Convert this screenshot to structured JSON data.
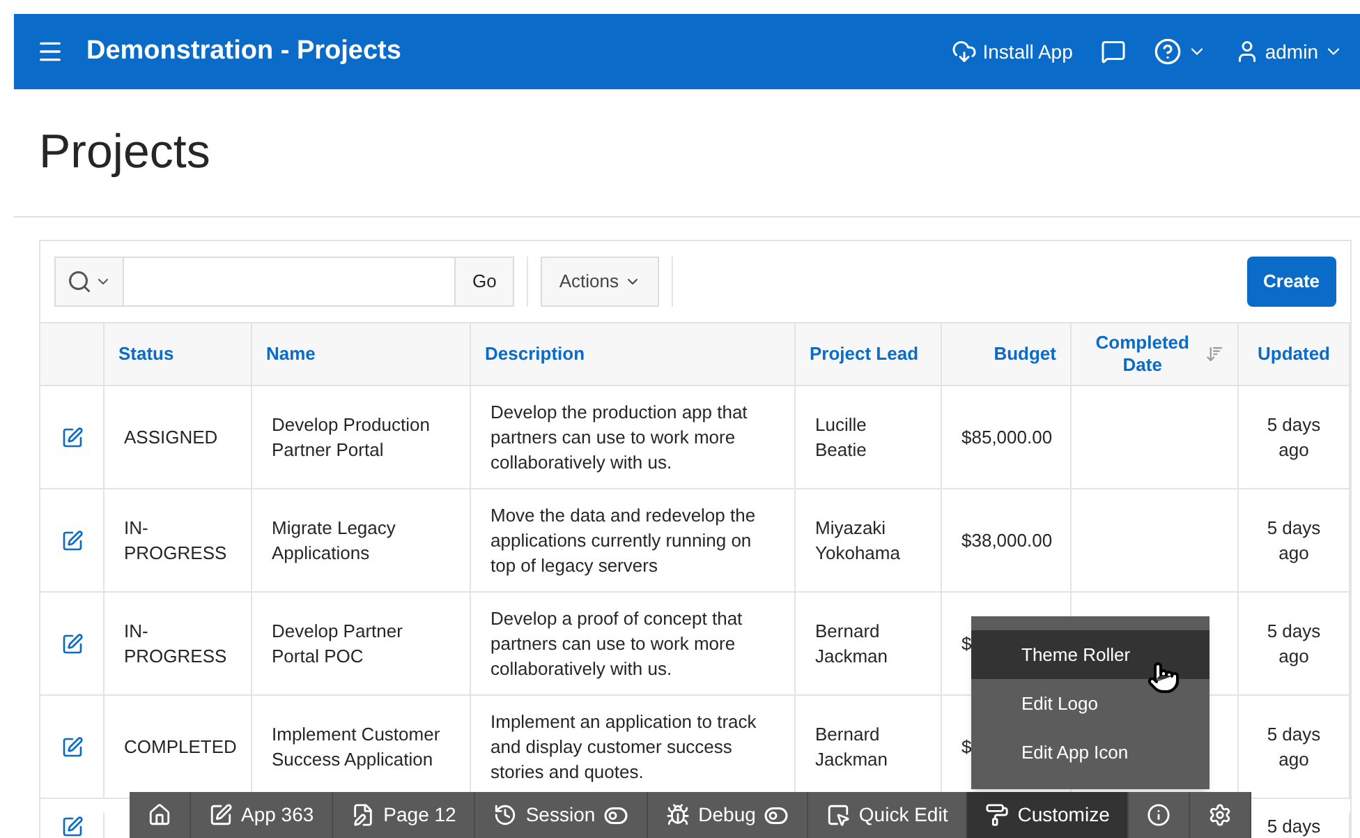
{
  "header": {
    "title": "Demonstration - Projects",
    "install": "Install App",
    "user": "admin"
  },
  "page": {
    "title": "Projects"
  },
  "toolbar": {
    "go": "Go",
    "actions": "Actions",
    "create": "Create"
  },
  "table": {
    "columns": [
      {
        "label": "Status",
        "sorted": false
      },
      {
        "label": "Name",
        "sorted": false
      },
      {
        "label": "Description",
        "sorted": false
      },
      {
        "label": "Project Lead",
        "sorted": false
      },
      {
        "label": "Budget",
        "sorted": false
      },
      {
        "label": "Completed Date",
        "sorted": true
      },
      {
        "label": "Updated",
        "sorted": false
      }
    ],
    "rows": [
      {
        "cells": [
          "ASSIGNED",
          "Develop Production Partner Portal",
          "Develop the production app that partners can use to work more collaboratively with us.",
          "Lucille Beatie",
          "$85,000.00",
          "",
          "5 days ago"
        ]
      },
      {
        "cells": [
          "IN-PROGRESS",
          "Migrate Legacy Applications",
          "Move the data and redevelop the applications currently running on top of legacy servers",
          "Miyazaki Yokohama",
          "$38,000.00",
          "",
          "5 days ago"
        ]
      },
      {
        "cells": [
          "IN-PROGRESS",
          "Develop Partner Portal POC",
          "Develop a proof of concept that partners can use to work more collaboratively with us.",
          "Bernard Jackman",
          "$",
          "",
          "5 days ago"
        ]
      },
      {
        "cells": [
          "COMPLETED",
          "Implement Customer Success Application",
          "Implement an application to track and display customer success stories and quotes.",
          "Bernard Jackman",
          "$",
          "",
          "5 days ago"
        ]
      },
      {
        "cells": [
          "",
          "",
          "",
          "",
          "",
          "",
          "5 days"
        ]
      }
    ]
  },
  "menu": [
    {
      "label": "Theme Roller",
      "selected": true
    },
    {
      "label": "Edit Logo",
      "selected": false
    },
    {
      "label": "Edit App Icon",
      "selected": false
    }
  ],
  "devbar": [
    {
      "kind": "home",
      "selected": false
    },
    {
      "kind": "app",
      "label": "App 363",
      "selected": false
    },
    {
      "kind": "page",
      "label": "Page 12",
      "selected": false
    },
    {
      "kind": "session",
      "label": "Session",
      "selected": false
    },
    {
      "kind": "debug",
      "label": "Debug",
      "selected": false
    },
    {
      "kind": "quickedit",
      "label": "Quick Edit",
      "selected": false
    },
    {
      "kind": "customize",
      "label": "Customize",
      "selected": true
    },
    {
      "kind": "info",
      "selected": false
    },
    {
      "kind": "settings",
      "selected": false
    }
  ]
}
